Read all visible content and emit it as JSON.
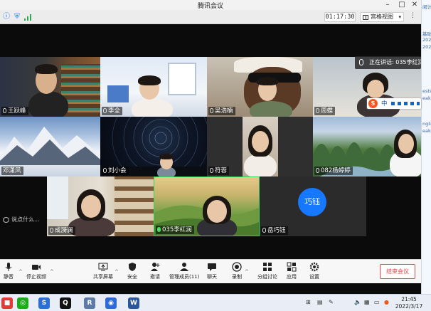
{
  "window": {
    "title": "腾讯会议"
  },
  "infobar": {
    "timer": "01:17:30",
    "view_label": "宫格视图"
  },
  "speaking": {
    "label": "正在讲话: 035李红润"
  },
  "participants": [
    {
      "name": "王跃峰"
    },
    {
      "name": "李全"
    },
    {
      "name": "吴浩楠"
    },
    {
      "name": "周蝶"
    },
    {
      "name": "邓潇凤"
    },
    {
      "name": "刘小会"
    },
    {
      "name": "符蓉"
    },
    {
      "name": "082杨婷婷"
    },
    {
      "name": "成漪澜"
    },
    {
      "name": "035李红润"
    },
    {
      "name": "岳巧钰",
      "initials": "巧钰"
    }
  ],
  "chat": {
    "placeholder": "说点什么..."
  },
  "toolbar": {
    "mute": "静音",
    "stop_video": "停止视频",
    "share": "共享屏幕",
    "security": "安全",
    "invite": "邀请",
    "members": "管理成员(11)",
    "chat": "聊天",
    "record": "录制",
    "breakout": "分组讨论",
    "apps": "应用",
    "settings": "设置",
    "end": "结束会议"
  },
  "ime": {
    "label": "中"
  },
  "taskbar": {
    "time": "21:45",
    "date": "2022/3/17"
  },
  "background_window": {
    "texts": [
      "阅计",
      "基础",
      "202",
      "202",
      "ests",
      "eak",
      "ngli",
      "eak"
    ]
  }
}
